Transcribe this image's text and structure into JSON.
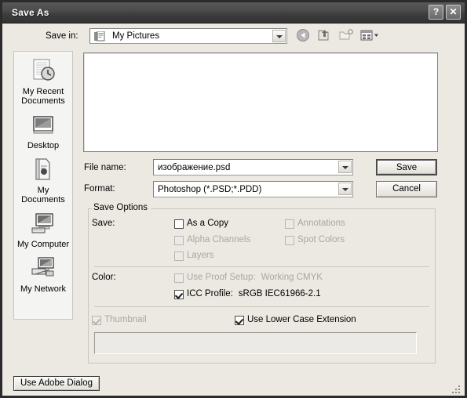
{
  "window": {
    "title": "Save As",
    "help_button": "?",
    "close_button": "✕"
  },
  "toolbar": {
    "save_in_label": "Save in:",
    "save_in_value": "My Pictures",
    "icons": [
      {
        "name": "back-icon",
        "tooltip": "Back"
      },
      {
        "name": "up-one-level-icon",
        "tooltip": "Up One Level"
      },
      {
        "name": "create-new-folder-icon",
        "tooltip": "Create New Folder"
      },
      {
        "name": "views-icon",
        "tooltip": "Views"
      }
    ]
  },
  "places": [
    {
      "label": "My Recent Documents",
      "icon": "recent-documents-icon"
    },
    {
      "label": "Desktop",
      "icon": "desktop-icon"
    },
    {
      "label": "My Documents",
      "icon": "my-documents-icon"
    },
    {
      "label": "My Computer",
      "icon": "my-computer-icon"
    },
    {
      "label": "My Network",
      "icon": "my-network-icon"
    }
  ],
  "file_list": {
    "items": []
  },
  "fields": {
    "file_name_label": "File name:",
    "file_name_value": "изображение.psd",
    "format_label": "Format:",
    "format_value": "Photoshop (*.PSD;*.PDD)"
  },
  "buttons": {
    "save": "Save",
    "cancel": "Cancel",
    "use_adobe_dialog": "Use Adobe Dialog"
  },
  "save_options": {
    "legend": "Save Options",
    "save_section_label": "Save:",
    "color_section_label": "Color:",
    "checkboxes": [
      {
        "id": "as_a_copy",
        "label": "As a Copy",
        "checked": false,
        "disabled": false
      },
      {
        "id": "alpha_channels",
        "label": "Alpha Channels",
        "checked": false,
        "disabled": true
      },
      {
        "id": "layers",
        "label": "Layers",
        "checked": false,
        "disabled": true
      },
      {
        "id": "annotations",
        "label": "Annotations",
        "checked": false,
        "disabled": true
      },
      {
        "id": "spot_colors",
        "label": "Spot Colors",
        "checked": false,
        "disabled": true
      },
      {
        "id": "use_proof_setup",
        "label": "Use Proof Setup:",
        "value": "Working CMYK",
        "checked": false,
        "disabled": true
      },
      {
        "id": "icc_profile",
        "label": "ICC Profile:",
        "value": "sRGB IEC61966-2.1",
        "checked": true,
        "disabled": false
      },
      {
        "id": "thumbnail",
        "label": "Thumbnail",
        "checked": true,
        "disabled": true
      },
      {
        "id": "lower_case_ext",
        "label": "Use Lower Case Extension",
        "checked": true,
        "disabled": false
      }
    ]
  },
  "colors": {
    "titlebar_dark": "#3e3e3e",
    "dialog_face": "#ece9e3",
    "window_border": "#2b2b2b",
    "disabled_text": "#a9a7a3",
    "field_white": "#ffffff"
  }
}
